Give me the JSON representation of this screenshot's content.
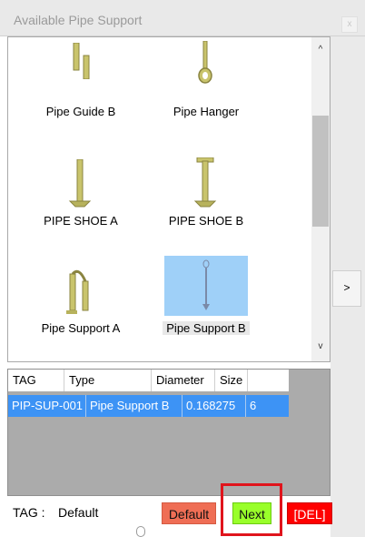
{
  "window": {
    "title": "Available Pipe Support",
    "close_glyph": "x"
  },
  "side_panel": {
    "expand_glyph": ">"
  },
  "gallery": {
    "items": [
      {
        "label": "Pipe Guide B",
        "icon": "pipe-guide-b-icon"
      },
      {
        "label": "Pipe Hanger",
        "icon": "pipe-hanger-icon"
      },
      {
        "label": "PIPE SHOE A",
        "icon": "pipe-shoe-a-icon"
      },
      {
        "label": "PIPE SHOE B",
        "icon": "pipe-shoe-b-icon"
      },
      {
        "label": "Pipe Support A",
        "icon": "pipe-support-a-icon"
      },
      {
        "label": "Pipe Support B",
        "icon": "pipe-support-b-icon",
        "selected": true
      }
    ],
    "scroll_up_glyph": "^",
    "scroll_down_glyph": "v"
  },
  "grid": {
    "columns": [
      "TAG",
      "Type",
      "Diameter",
      "Size"
    ],
    "rows": [
      [
        "PIP-SUP-001",
        "Pipe Support B",
        "0.168275",
        "6"
      ]
    ],
    "selected_row_color": "#3d93f5"
  },
  "bottom": {
    "tag_label": "TAG :",
    "tag_value": "Default",
    "default_button": "Default",
    "next_button": "Next",
    "delete_button": "[DEL]"
  },
  "colors": {
    "default_button": "#ef6e55",
    "next_button": "#99ff2a",
    "delete_button": "#ff0000",
    "highlight": "#e0141c",
    "selection": "#9fd0f8"
  }
}
